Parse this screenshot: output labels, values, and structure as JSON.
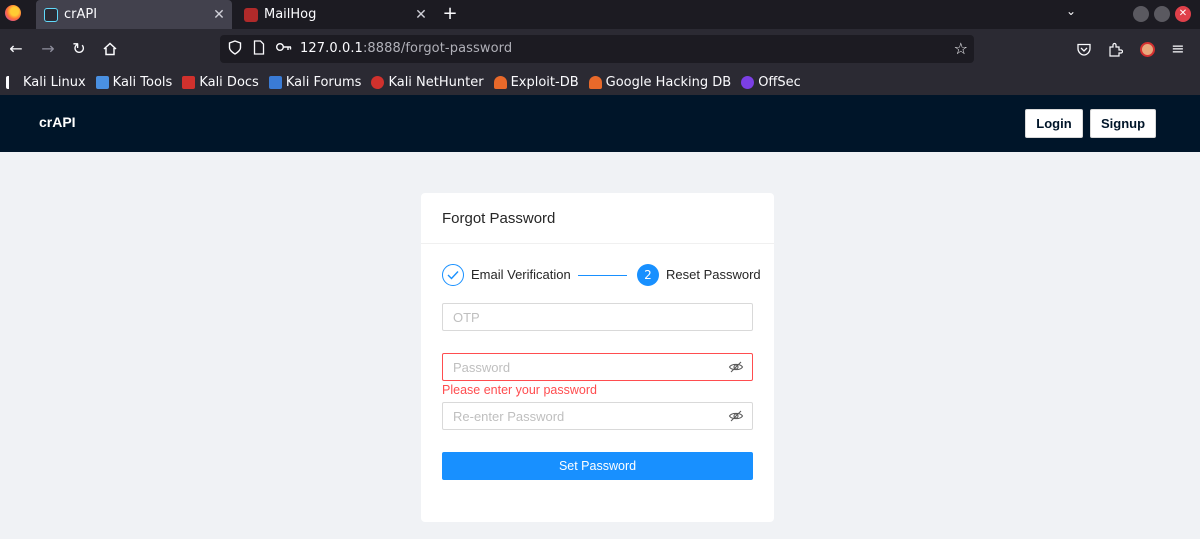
{
  "browser": {
    "tabs": [
      {
        "title": "crAPI",
        "active": true
      },
      {
        "title": "MailHog",
        "active": false
      }
    ],
    "new_tab": "+",
    "tab_close": "✕",
    "url": {
      "host": "127.0.0.1",
      "rest": ":8888/forgot-password"
    },
    "bookmarks": [
      {
        "label": "Kali Linux",
        "color": "#3a7bd5"
      },
      {
        "label": "Kali Tools",
        "color": "#4a90e2"
      },
      {
        "label": "Kali Docs",
        "color": "#d0312d"
      },
      {
        "label": "Kali Forums",
        "color": "#3a7bd5"
      },
      {
        "label": "Kali NetHunter",
        "color": "#d0312d"
      },
      {
        "label": "Exploit-DB",
        "color": "#e8692a"
      },
      {
        "label": "Google Hacking DB",
        "color": "#e8692a"
      },
      {
        "label": "OffSec",
        "color": "#7b3fe4"
      }
    ]
  },
  "app": {
    "brand": "crAPI",
    "login_label": "Login",
    "signup_label": "Signup"
  },
  "form": {
    "title": "Forgot Password",
    "steps": [
      {
        "label": "Email Verification",
        "status": "done"
      },
      {
        "label": "Reset Password",
        "status": "current",
        "number": "2"
      }
    ],
    "otp": {
      "placeholder": "OTP",
      "value": ""
    },
    "password": {
      "placeholder": "Password",
      "value": "",
      "error": "Please enter your password"
    },
    "confirm_password": {
      "placeholder": "Re-enter Password",
      "value": ""
    },
    "submit_label": "Set Password"
  },
  "colors": {
    "primary": "#1890ff",
    "header_bg": "#001529",
    "error": "#ff4d4f",
    "page_bg": "#f0f2f5"
  }
}
